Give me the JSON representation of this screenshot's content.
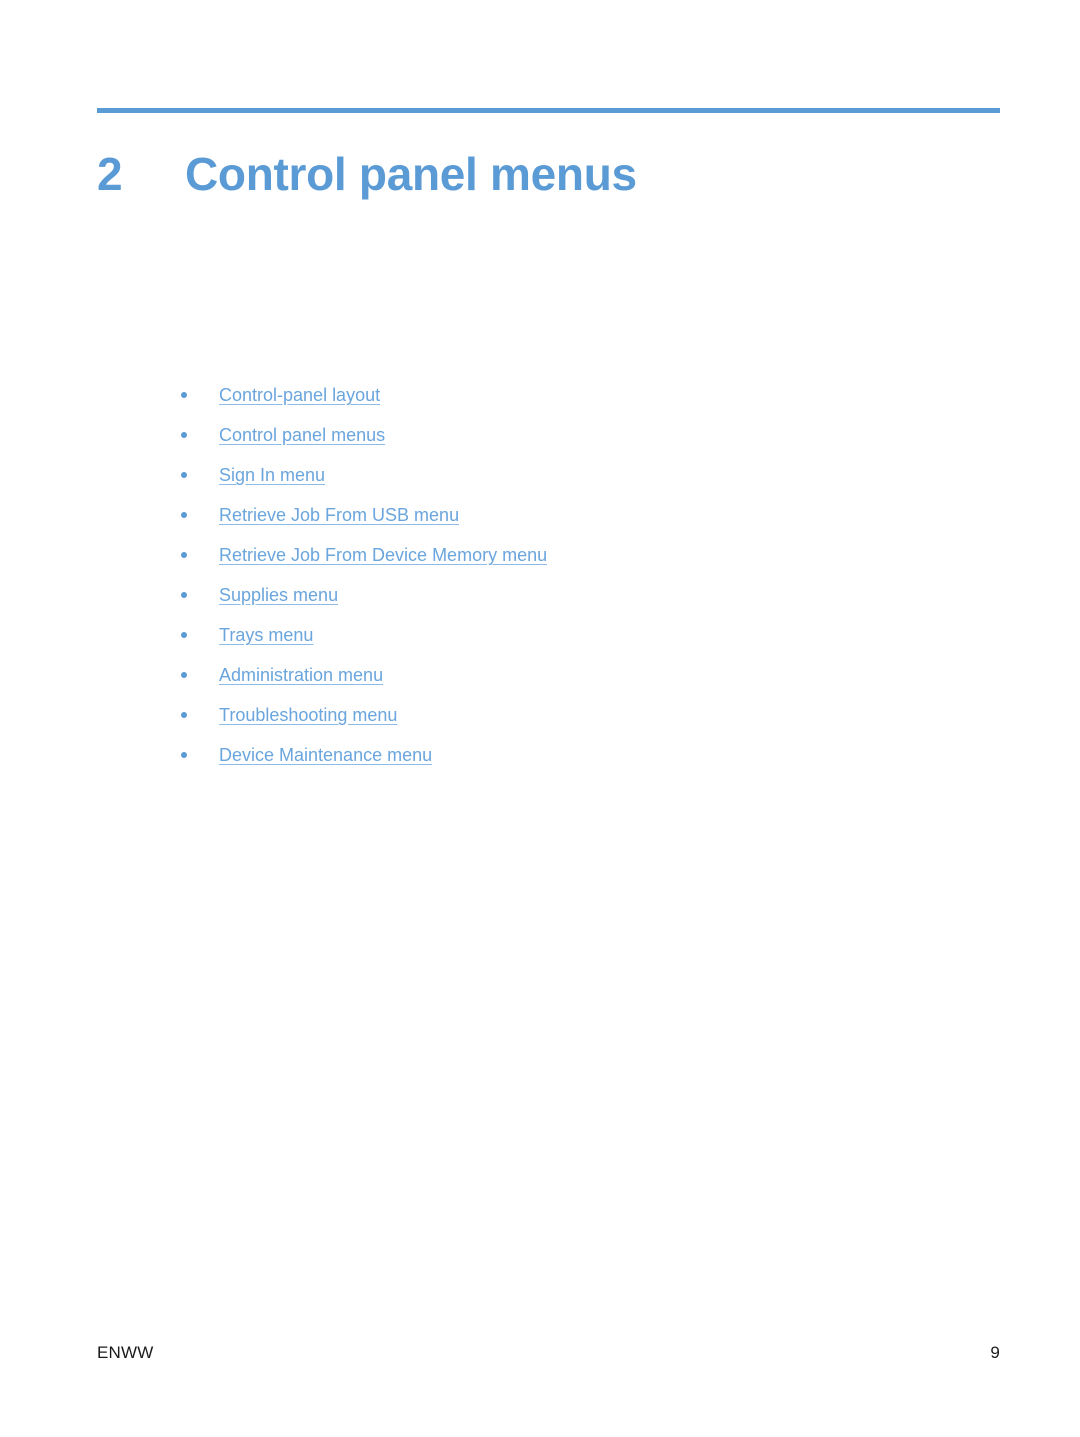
{
  "document": {
    "chapter": {
      "number": "2",
      "title": "Control panel menus"
    },
    "accent_color": "#5b9bd5",
    "link_color": "#6aa5dd",
    "toc_links": [
      {
        "label": "Control-panel layout"
      },
      {
        "label": "Control panel menus"
      },
      {
        "label": "Sign In menu"
      },
      {
        "label": "Retrieve Job From USB menu"
      },
      {
        "label": "Retrieve Job From Device Memory menu"
      },
      {
        "label": "Supplies menu"
      },
      {
        "label": "Trays menu"
      },
      {
        "label": "Administration menu"
      },
      {
        "label": "Troubleshooting menu"
      },
      {
        "label": "Device Maintenance menu"
      }
    ],
    "footer": {
      "left": "ENWW",
      "page_number": "9"
    }
  }
}
